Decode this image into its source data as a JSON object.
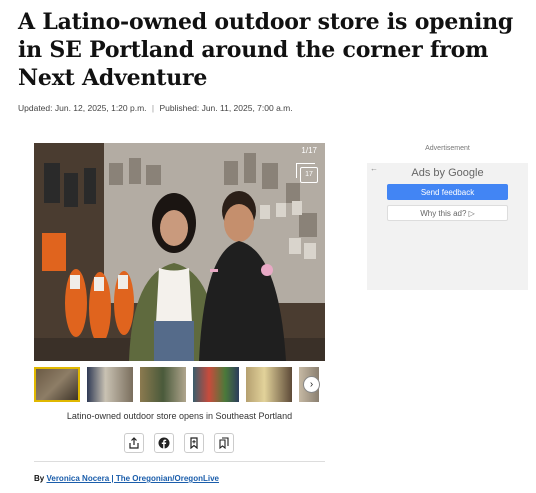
{
  "article": {
    "headline": "A Latino-owned outdoor store is opening in SE Portland around the corner from Next Adventure",
    "updated": "Updated: Jun. 12, 2025, 1:20 p.m.",
    "separator": "|",
    "published": "Published: Jun. 11, 2025, 7:00 a.m."
  },
  "gallery": {
    "counter": "1/17",
    "gallery_icon_label": "17",
    "caption": "Latino-owned outdoor store opens in Southeast Portland",
    "thumbnail_count": 6,
    "active_thumbnail": 1,
    "icons": {
      "next": "chevron-right-icon",
      "grid": "gallery-grid-icon"
    }
  },
  "share": {
    "buttons": [
      {
        "name": "share-icon"
      },
      {
        "name": "facebook-icon"
      },
      {
        "name": "bookmark-add-icon"
      },
      {
        "name": "saved-bookmarks-icon"
      }
    ]
  },
  "byline": {
    "by": "By",
    "author": "Veronica Nocera | The Oregonian/OregonLive"
  },
  "ad": {
    "label": "Advertisement",
    "ads_by_prefix": "Ads by ",
    "ads_by_brand": "Google",
    "send_feedback": "Send feedback",
    "why_this_ad": "Why this ad? ▷",
    "feedback_color": "#4285f4"
  }
}
